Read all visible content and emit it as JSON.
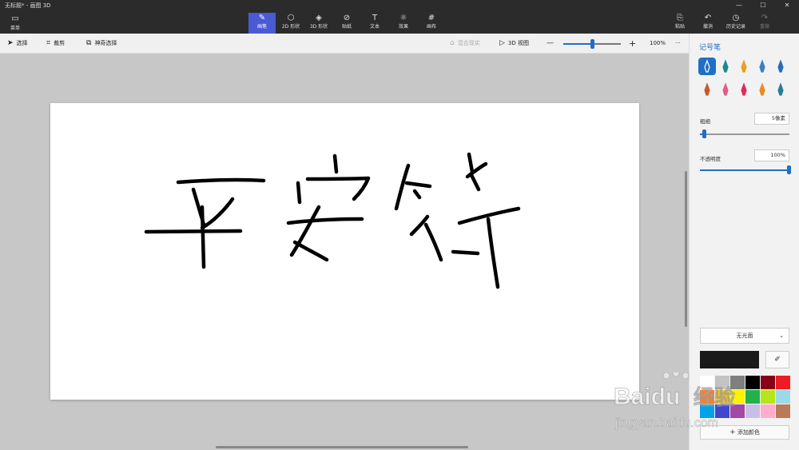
{
  "window": {
    "title": "无标题* - 画图 3D",
    "controls": [
      "—",
      "☐",
      "✕"
    ]
  },
  "ribbon": {
    "menu_label": "菜单",
    "tools": [
      {
        "label": "画笔",
        "icon": "brush-icon",
        "glyph": "✎",
        "active": true
      },
      {
        "label": "2D 形状",
        "icon": "2d-shapes-icon",
        "glyph": "⬡"
      },
      {
        "label": "3D 形状",
        "icon": "3d-shapes-icon",
        "glyph": "◈"
      },
      {
        "label": "贴纸",
        "icon": "sticker-icon",
        "glyph": "⊘"
      },
      {
        "label": "文本",
        "icon": "text-icon",
        "glyph": "T"
      },
      {
        "label": "效果",
        "icon": "effects-icon",
        "glyph": "☼"
      },
      {
        "label": "画布",
        "icon": "canvas-icon",
        "glyph": "#"
      }
    ],
    "right_tools": [
      {
        "label": "粘贴",
        "icon": "paste-icon",
        "glyph": "⎘"
      },
      {
        "label": "撤消",
        "icon": "undo-icon",
        "glyph": "↶"
      },
      {
        "label": "历史记录",
        "icon": "history-icon",
        "glyph": "◷"
      },
      {
        "label": "重做",
        "icon": "redo-icon",
        "glyph": "↷",
        "disabled": true
      }
    ]
  },
  "toolbar": {
    "select_label": "选择",
    "crop_label": "裁剪",
    "magic_select_label": "神奇选择",
    "mixed_reality_label": "混合现实",
    "view3d_label": "3D 视图",
    "zoom_value": "100%",
    "zoom_level": 0.5,
    "more": "···"
  },
  "panel": {
    "title": "记号笔",
    "brushes": [
      {
        "icon": "marker-icon",
        "color": "#1f6fc4",
        "selected": true
      },
      {
        "icon": "calligraphy-pen-icon",
        "color": "#1a8a8a"
      },
      {
        "icon": "oil-brush-icon",
        "color": "#e8a020"
      },
      {
        "icon": "watercolor-icon",
        "color": "#3a7fc4"
      },
      {
        "icon": "pixel-pen-icon",
        "color": "#2b6cb0"
      },
      {
        "icon": "pencil-icon",
        "color": "#c85a2a"
      },
      {
        "icon": "eraser-icon",
        "color": "#e05a8a"
      },
      {
        "icon": "crayon-icon",
        "color": "#e02a5a"
      },
      {
        "icon": "spray-can-icon",
        "color": "#e88a20"
      },
      {
        "icon": "fill-icon",
        "color": "#2a7a9a"
      }
    ],
    "thickness_label": "粗细",
    "thickness_value": "5像素",
    "thickness_level": 0.03,
    "opacity_label": "不透明度",
    "opacity_value": "100%",
    "opacity_level": 1.0,
    "finish_label": "无光面",
    "current_color": "#1a1a1a",
    "palette": [
      "#ffffff",
      "#c3c3c3",
      "#7f7f7f",
      "#000000",
      "#880015",
      "#ed1c24",
      "#ff7f27",
      "#ffc90e",
      "#fff200",
      "#22b14c",
      "#b5e61d",
      "#99d9ea",
      "#00a2e8",
      "#3f48cc",
      "#a349a4",
      "#c8bfe7",
      "#ffaec9",
      "#b97a57"
    ],
    "add_color_label": "添加颜色"
  },
  "watermark": {
    "text_latin": "Baidu",
    "text_cn": "经验",
    "url": "jingyan.baidu.com"
  }
}
